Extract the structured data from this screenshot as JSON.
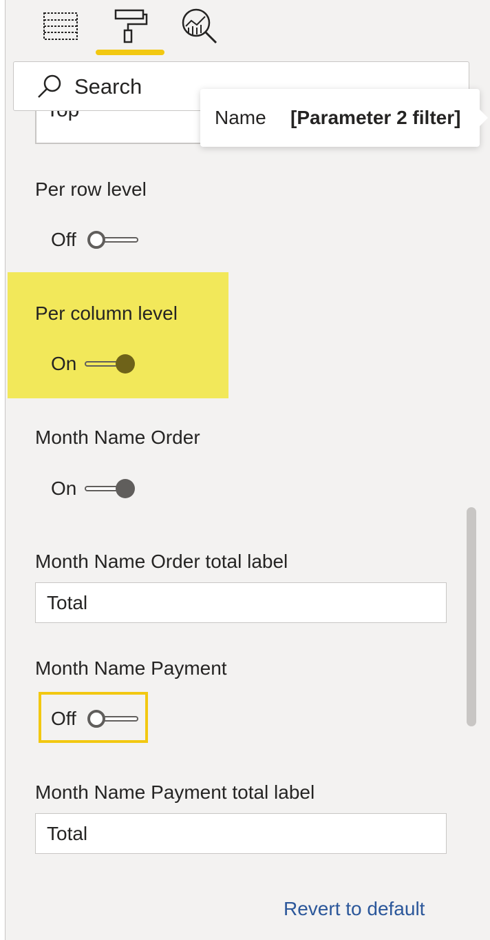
{
  "tabs": [
    {
      "icon": "fields-icon"
    },
    {
      "icon": "format-paint-roller-icon",
      "active": true
    },
    {
      "icon": "analytics-magnifier-icon"
    }
  ],
  "search": {
    "placeholder": "Search",
    "icon": "search-icon"
  },
  "partial_field": {
    "value": "Top"
  },
  "tooltip": {
    "key": "Name",
    "value": "[Parameter 2 filter]"
  },
  "settings": {
    "per_row_level": {
      "label": "Per row level",
      "state": "Off"
    },
    "per_column_level": {
      "label": "Per column level",
      "state": "On"
    },
    "month_name_order": {
      "label": "Month Name Order",
      "state": "On"
    },
    "month_name_order_total_label": {
      "label": "Month Name Order total label",
      "value": "Total"
    },
    "month_name_payment": {
      "label": "Month Name Payment",
      "state": "Off"
    },
    "month_name_payment_total_label": {
      "label": "Month Name Payment total label",
      "value": "Total"
    }
  },
  "revert": {
    "label": "Revert to default"
  },
  "colors": {
    "accent": "#f2c811",
    "highlight": "#f2e85a",
    "link": "#2b579a",
    "pane_bg": "#f3f2f1",
    "toggle_on": "#605e5c"
  }
}
